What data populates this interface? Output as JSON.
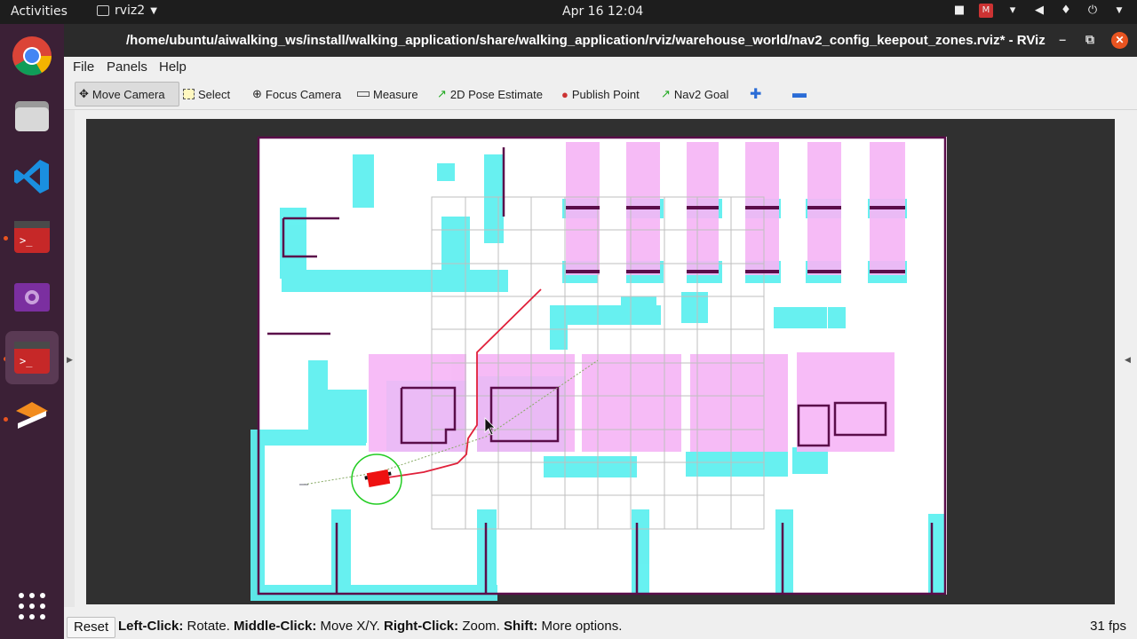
{
  "topbar": {
    "activities": "Activities",
    "app_name": "rviz2",
    "clock": "Apr 16  12:04"
  },
  "window": {
    "title": "/home/ubuntu/aiwalking_ws/install/walking_application/share/walking_application/rviz/warehouse_world/nav2_config_keepout_zones.rviz* - RViz"
  },
  "menu": {
    "file": "File",
    "panels": "Panels",
    "help": "Help"
  },
  "toolbar": {
    "move_camera": "Move Camera",
    "select": "Select",
    "focus_camera": "Focus Camera",
    "measure": "Measure",
    "pose_estimate": "2D Pose Estimate",
    "publish_point": "Publish Point",
    "nav2_goal": "Nav2 Goal"
  },
  "status": {
    "reset": "Reset",
    "hint_left_key": "Left-Click:",
    "hint_left": " Rotate. ",
    "hint_middle_key": "Middle-Click:",
    "hint_middle": " Move X/Y. ",
    "hint_right_key": "Right-Click:",
    "hint_right": " Zoom. ",
    "hint_shift_key": "Shift:",
    "hint_shift": " More options.",
    "fps": "31 fps"
  },
  "colors": {
    "keepout": "#f6b6f6",
    "inflation": "#5ff0f0",
    "obstacle": "#5a0d4a",
    "path": "#e0203a",
    "robot": "#ee1111",
    "footprint": "#22cc22"
  }
}
